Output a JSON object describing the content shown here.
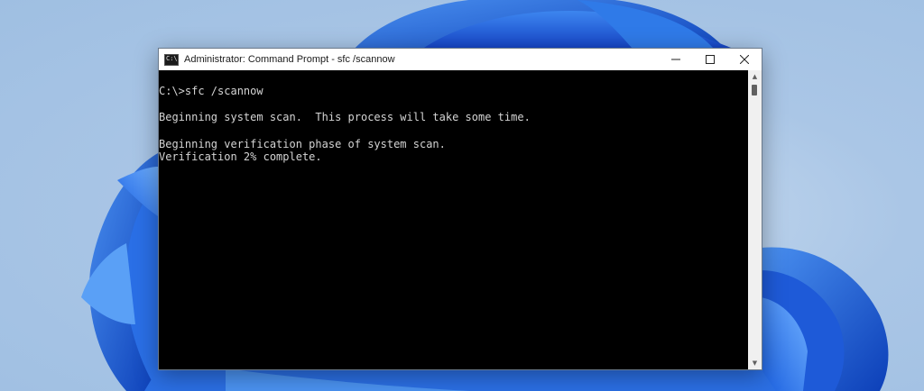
{
  "window": {
    "title": "Administrator: Command Prompt - sfc  /scannow",
    "app_icon_text": "C:\\",
    "controls": {
      "minimize_icon": "minimize-icon",
      "maximize_icon": "maximize-icon",
      "close_icon": "close-icon"
    }
  },
  "console": {
    "lines": [
      "C:\\>sfc /scannow",
      "",
      "Beginning system scan.  This process will take some time.",
      "",
      "Beginning verification phase of system scan.",
      "Verification 2% complete."
    ],
    "background": "#000000",
    "foreground": "#d4d4d4"
  },
  "scrollbar": {
    "up_icon": "scroll-up-icon",
    "down_icon": "scroll-down-icon"
  },
  "colors": {
    "wallpaper": "#aac6e6",
    "bloom": "#1a5fe0",
    "titlebar": "#ffffff"
  }
}
